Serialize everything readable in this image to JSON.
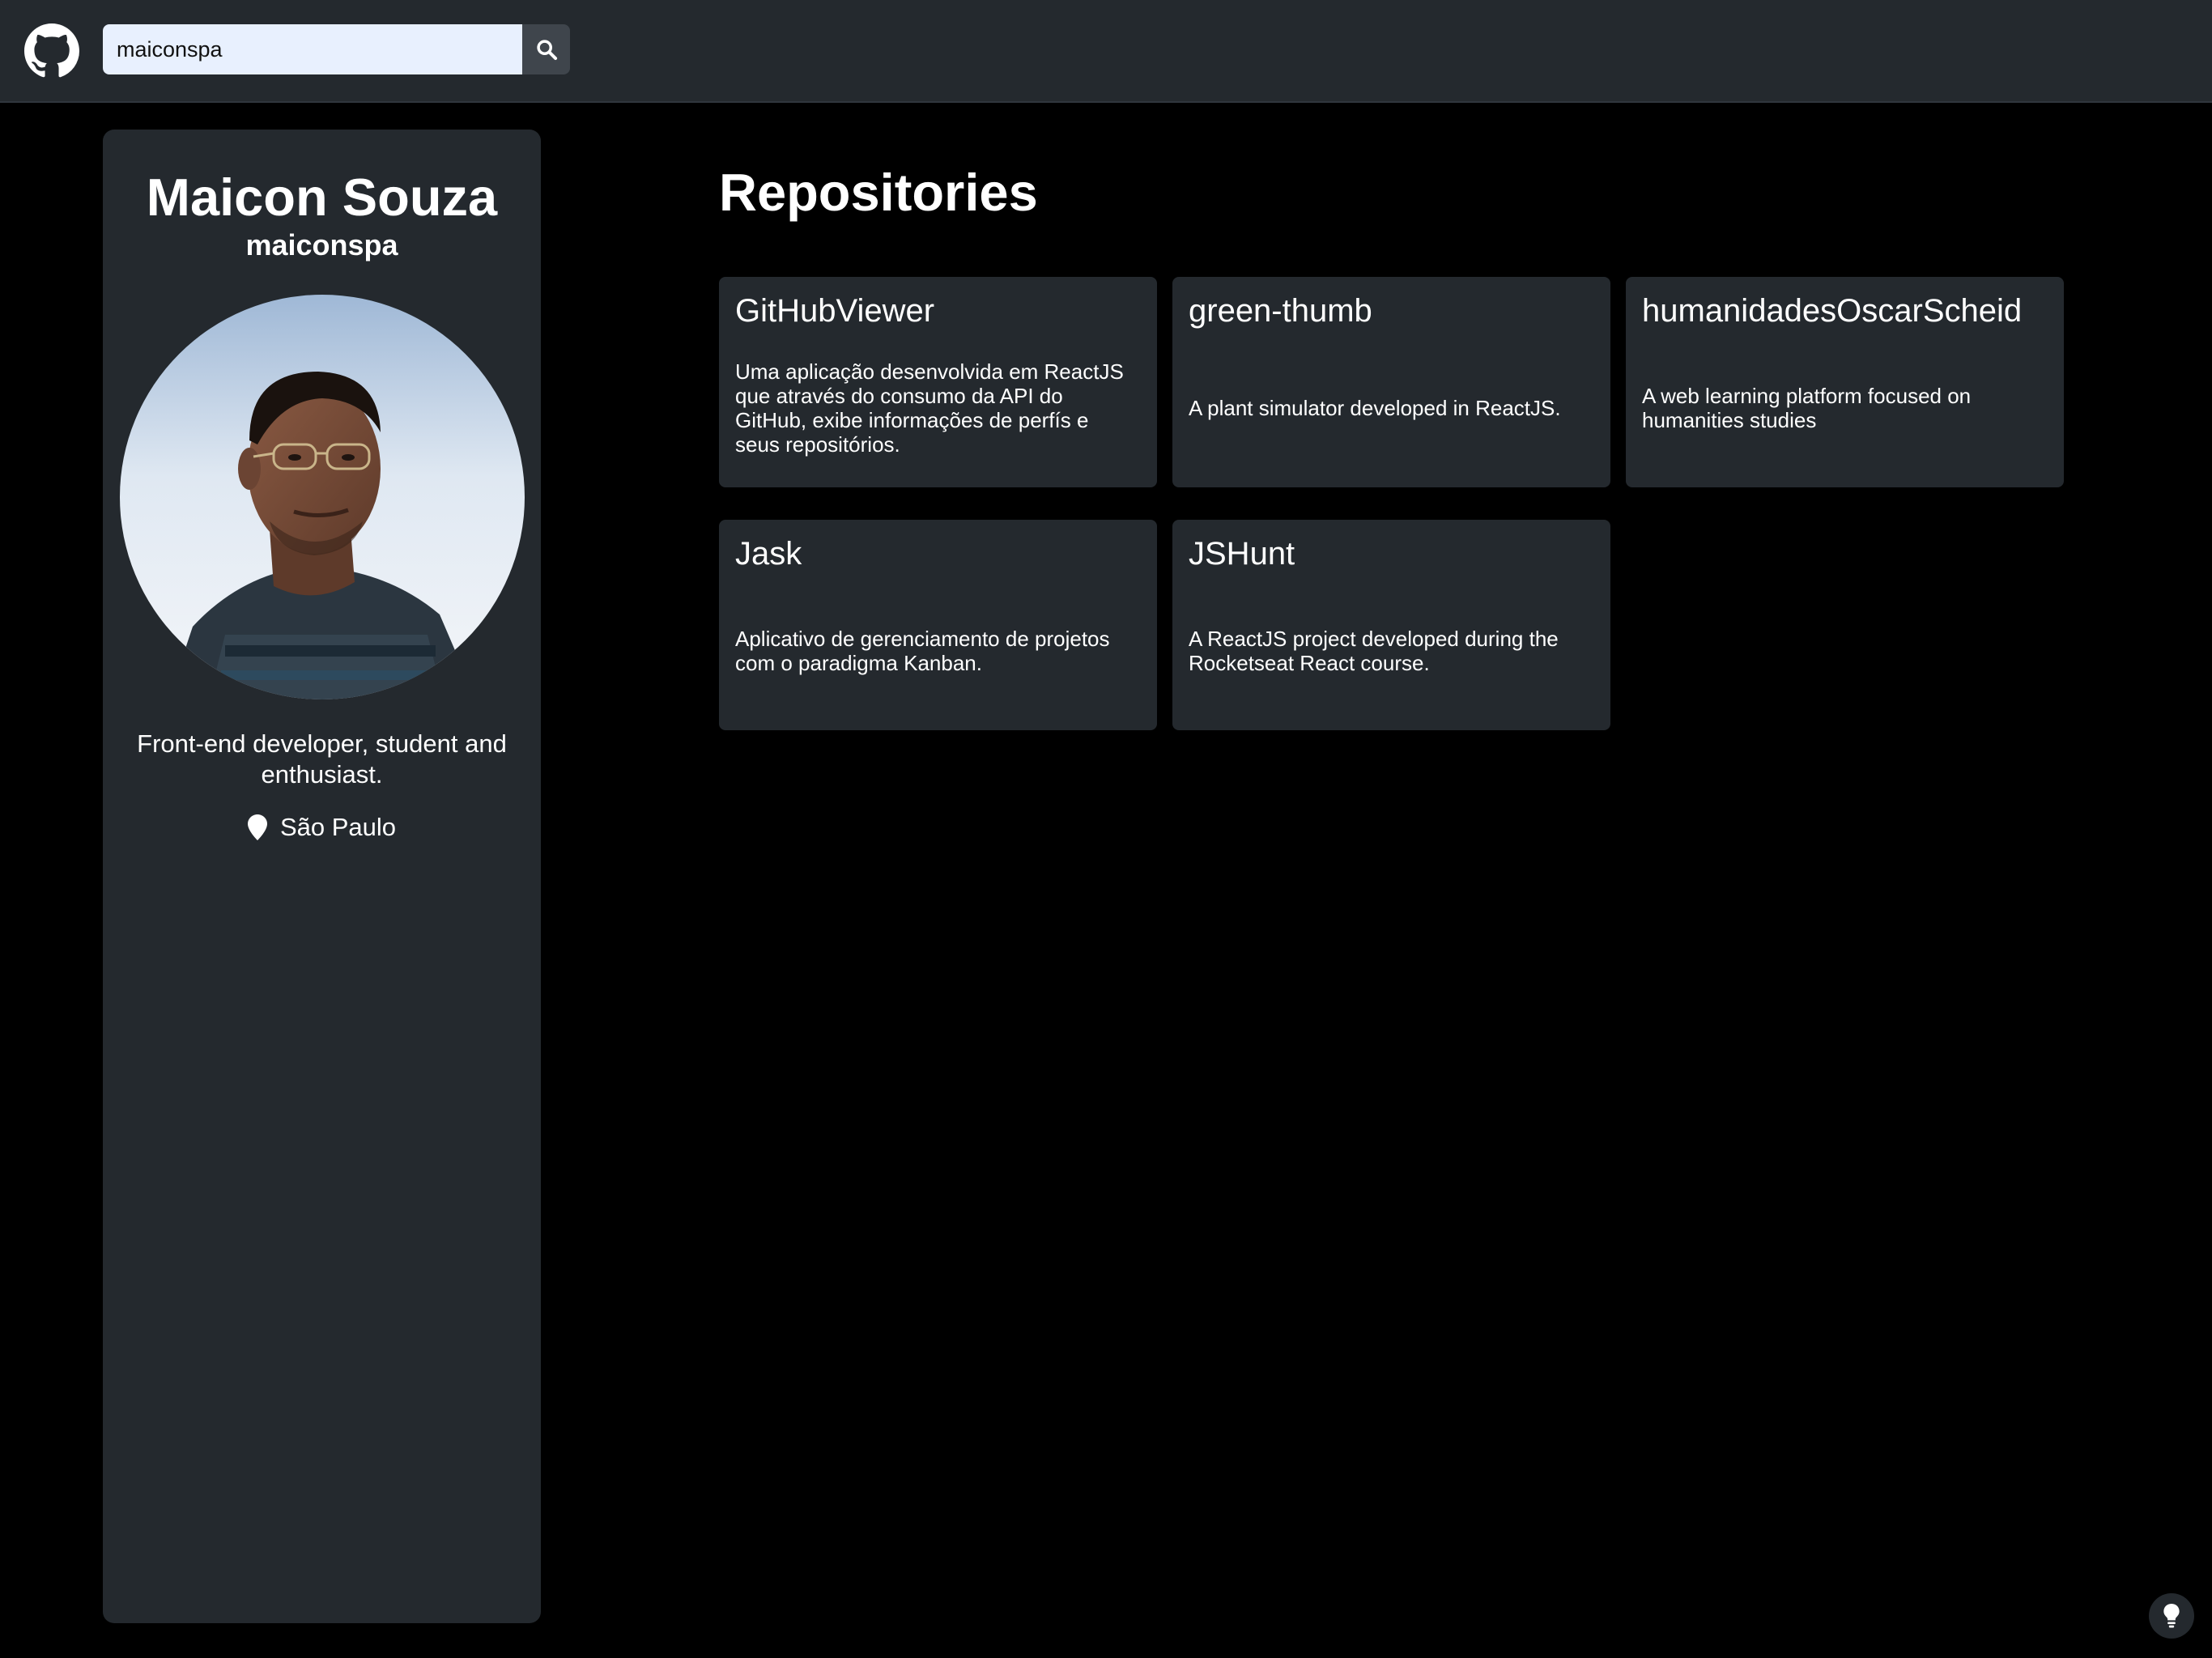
{
  "header": {
    "logo_icon": "github-icon",
    "search": {
      "value": "maiconspa",
      "button_icon": "search-icon"
    }
  },
  "profile": {
    "name": "Maicon Souza",
    "login": "maiconspa",
    "avatar_alt": "Maicon Souza",
    "bio": "Front-end developer, student and enthusiast.",
    "location_icon": "map-pin-icon",
    "location": "São Paulo"
  },
  "repositories": {
    "title": "Repositories",
    "items": [
      {
        "name": "GitHubViewer",
        "description": "Uma aplicação desenvolvida em ReactJS que através do consumo da API do GitHub, exibe informações de perfís e seus repositórios."
      },
      {
        "name": "green-thumb",
        "description": "A plant simulator developed in ReactJS."
      },
      {
        "name": "humanidadesOscarScheid",
        "description": "A web learning platform focused on humanities studies"
      },
      {
        "name": "Jask",
        "description": "Aplicativo de gerenciamento de projetos com o paradigma Kanban."
      },
      {
        "name": "JSHunt",
        "description": "A ReactJS project developed during the Rocketseat React course."
      }
    ]
  },
  "help_button_icon": "lightbulb-icon",
  "colors": {
    "background": "#000000",
    "surface": "#24292e",
    "search_field": "#e8f0fe",
    "search_button": "#3f454c",
    "text": "#ffffff"
  }
}
